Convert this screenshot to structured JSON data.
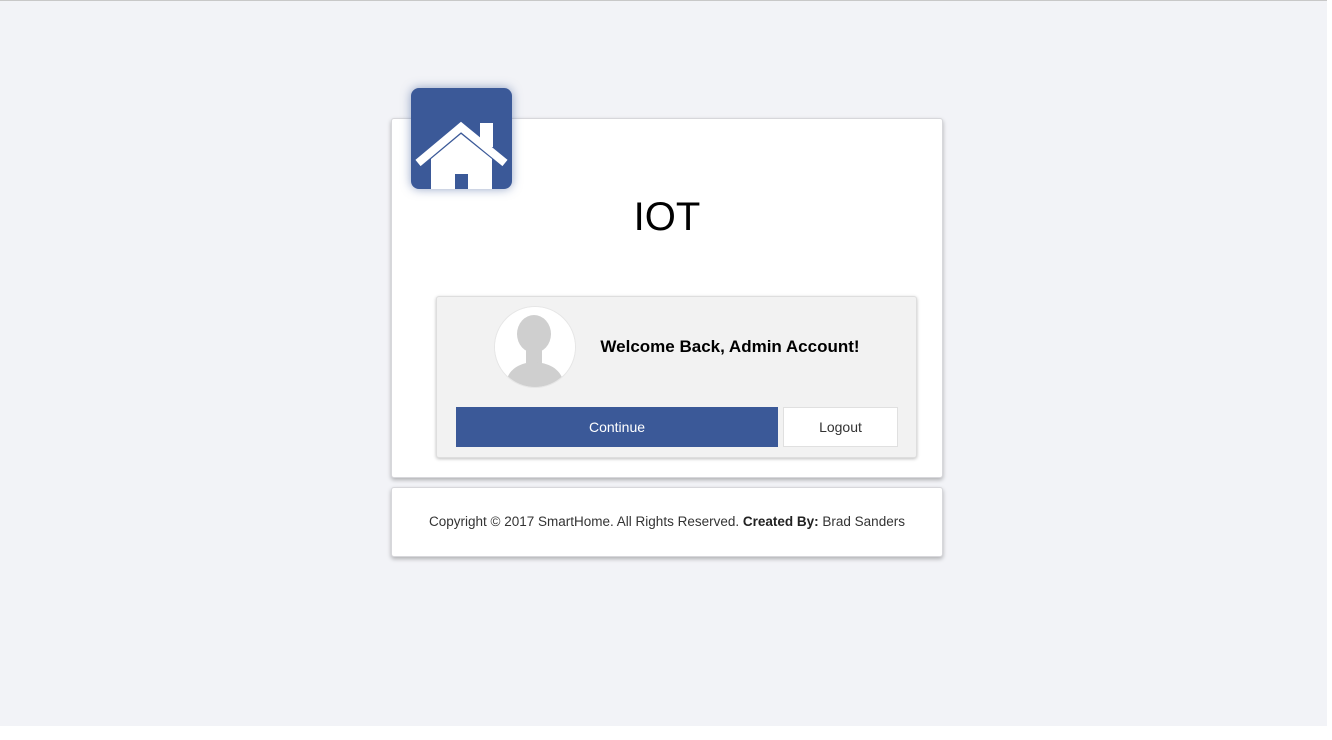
{
  "app": {
    "title": "IOT",
    "logo_icon": "house-icon",
    "brand_color": "#3b5998"
  },
  "welcome": {
    "avatar_icon": "user-silhouette-icon",
    "message": "Welcome Back, Admin Account!"
  },
  "actions": {
    "continue_label": "Continue",
    "logout_label": "Logout"
  },
  "footer": {
    "copyright": "Copyright © 2017 SmartHome. All Rights Reserved.",
    "created_by_label": "Created By:",
    "author": "Brad Sanders"
  }
}
